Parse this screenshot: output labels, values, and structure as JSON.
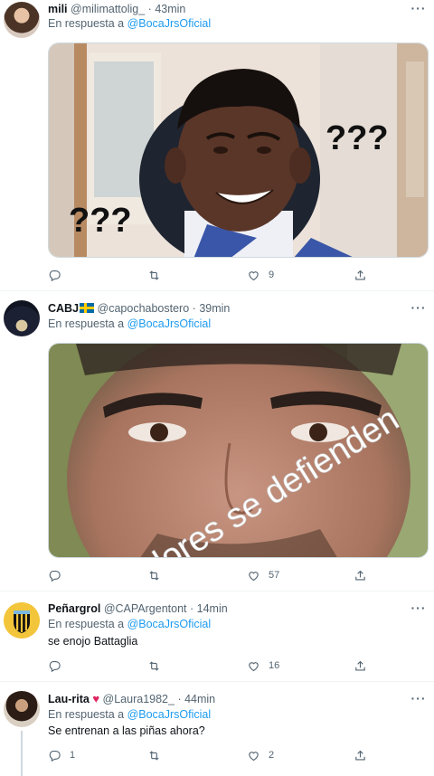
{
  "tweets": [
    {
      "name": "mili",
      "handle": "@milimattolig_",
      "time": "43min",
      "reply_prefix": "En respuesta a ",
      "reply_to": "@BocaJrsOficial",
      "media_text": [
        "???",
        "???"
      ],
      "counts": {
        "reply": "",
        "retweet": "",
        "like": "9"
      }
    },
    {
      "name": "CABJ",
      "handle": "@capochabostero",
      "time": "39min",
      "reply_prefix": "En respuesta a ",
      "reply_to": "@BocaJrsOficial",
      "media_text": "dores se defienden",
      "counts": {
        "reply": "",
        "retweet": "",
        "like": "57"
      }
    },
    {
      "name": "Peñargrol",
      "handle": "@CAPArgentont",
      "time": "14min",
      "reply_prefix": "En respuesta a ",
      "reply_to": "@BocaJrsOficial",
      "text": "se enojo Battaglia",
      "counts": {
        "reply": "",
        "retweet": "",
        "like": "16"
      }
    },
    {
      "name": "Lau-rita",
      "handle": "@Laura1982_",
      "time": "44min",
      "reply_prefix": "En respuesta a ",
      "reply_to": "@BocaJrsOficial",
      "text": "Se entrenan a las piñas ahora?",
      "counts": {
        "reply": "1",
        "retweet": "",
        "like": "2"
      }
    }
  ],
  "separator": "·",
  "colors": {
    "link": "#1d9bf0",
    "muted": "#536471",
    "heart_emoji": "#e0245e",
    "flag_blue": "#006aa7",
    "flag_yellow": "#fecc00"
  },
  "icons": [
    "reply-icon",
    "retweet-icon",
    "like-icon",
    "share-icon",
    "more-icon",
    "red-heart-emoji",
    "sweden-flag-emoji"
  ]
}
